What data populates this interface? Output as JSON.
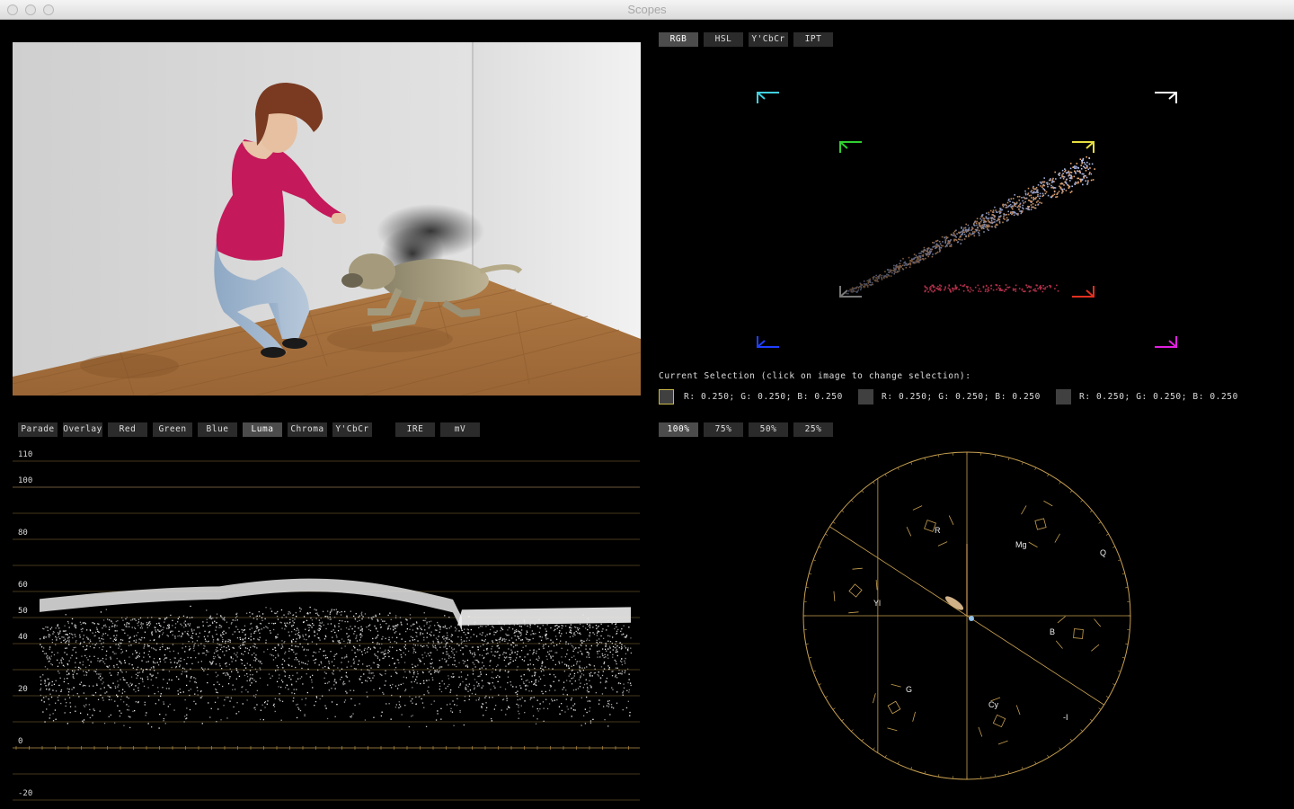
{
  "window": {
    "title": "Scopes"
  },
  "gamut": {
    "modes": [
      {
        "label": "RGB",
        "active": true
      },
      {
        "label": "HSL",
        "active": false
      },
      {
        "label": "Y'CbCr",
        "active": false
      },
      {
        "label": "IPT",
        "active": false
      }
    ]
  },
  "selection": {
    "caption": "Current Selection (click on image to change selection):",
    "samples": [
      {
        "value": "R: 0.250; G: 0.250; B: 0.250",
        "color": "#404040",
        "selected": true
      },
      {
        "value": "R: 0.250; G: 0.250; B: 0.250",
        "color": "#404040",
        "selected": false
      },
      {
        "value": "R: 0.250; G: 0.250; B: 0.250",
        "color": "#404040",
        "selected": false
      }
    ]
  },
  "waveform": {
    "modes": [
      {
        "label": "Parade",
        "active": false
      },
      {
        "label": "Overlay",
        "active": false
      },
      {
        "label": "Red",
        "active": false
      },
      {
        "label": "Green",
        "active": false
      },
      {
        "label": "Blue",
        "active": false
      },
      {
        "label": "Luma",
        "active": true
      },
      {
        "label": "Chroma",
        "active": false
      },
      {
        "label": "Y'CbCr",
        "active": false
      }
    ],
    "units": [
      {
        "label": "IRE",
        "active": false
      },
      {
        "label": "mV",
        "active": false
      }
    ],
    "scale_labels": [
      "110",
      "100",
      "80",
      "60",
      "50",
      "40",
      "20",
      "0",
      "-20"
    ]
  },
  "vectorscope": {
    "zoom": [
      {
        "label": "100%",
        "active": true
      },
      {
        "label": "75%",
        "active": false
      },
      {
        "label": "50%",
        "active": false
      },
      {
        "label": "25%",
        "active": false
      }
    ],
    "targets": [
      "R",
      "Mg",
      "Yl",
      "B",
      "G",
      "Cy"
    ],
    "axes": [
      "Q",
      "-I"
    ]
  },
  "colors": {
    "graticule": "#c8a050",
    "button_bg": "#2b2b2b",
    "button_active_bg": "#4c4c4c",
    "selection_border": "#c9b84a",
    "shirt": "#c4195a",
    "floor": "#a8743e",
    "gamut_red": "#e03020",
    "gamut_green": "#30d030",
    "gamut_blue": "#2040ff",
    "gamut_cyan": "#40d0e0",
    "gamut_magenta": "#e020e0",
    "gamut_yellow": "#e8e040"
  }
}
